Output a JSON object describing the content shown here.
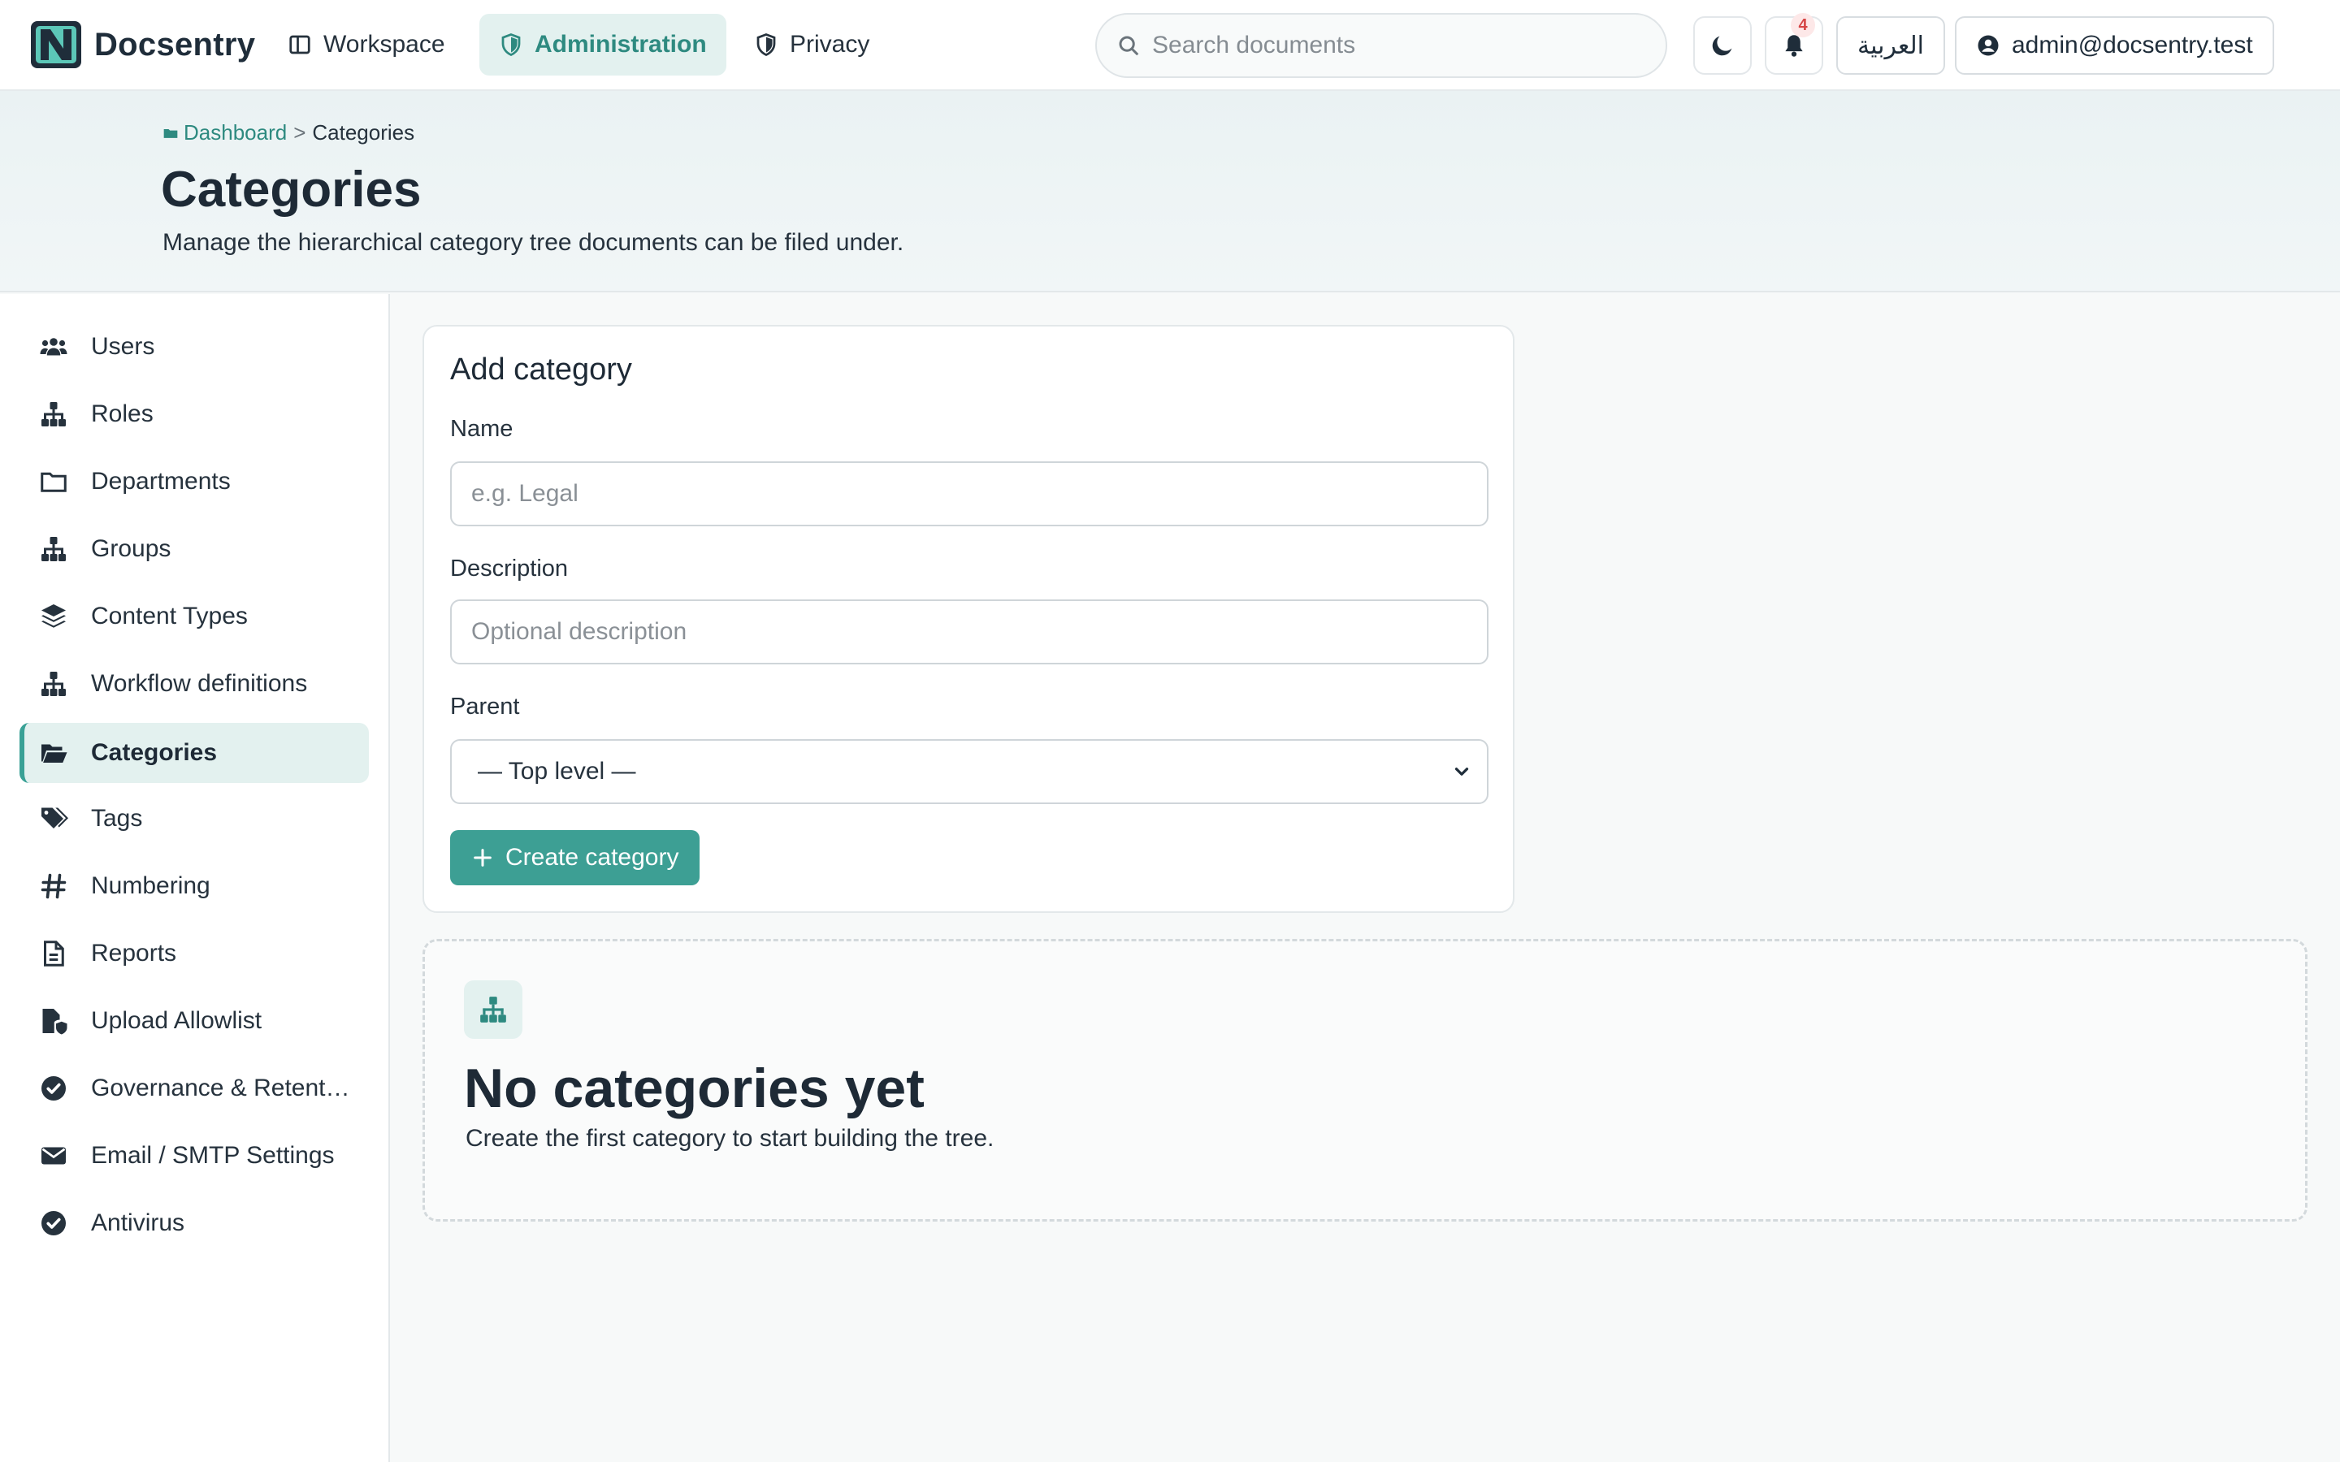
{
  "app": {
    "name": "Docsentry"
  },
  "nav": {
    "items": [
      {
        "label": "Workspace",
        "icon": "layout-icon"
      },
      {
        "label": "Administration",
        "icon": "shield-icon",
        "active": true
      },
      {
        "label": "Privacy",
        "icon": "shield-icon"
      }
    ]
  },
  "search": {
    "placeholder": "Search documents"
  },
  "header_actions": {
    "theme_icon": "moon-icon",
    "notifications_count": "4",
    "language_label": "العربية",
    "user_email": "admin@docsentry.test"
  },
  "breadcrumb": {
    "parent": "Dashboard",
    "separator": ">",
    "current": "Categories"
  },
  "page": {
    "title": "Categories",
    "subtitle": "Manage the hierarchical category tree documents can be filed under."
  },
  "sidebar": {
    "items": [
      {
        "label": "Users",
        "icon": "users-icon"
      },
      {
        "label": "Roles",
        "icon": "hierarchy-icon"
      },
      {
        "label": "Departments",
        "icon": "folder-icon"
      },
      {
        "label": "Groups",
        "icon": "hierarchy-icon"
      },
      {
        "label": "Content Types",
        "icon": "layers-icon"
      },
      {
        "label": "Workflow definitions",
        "icon": "hierarchy-icon"
      },
      {
        "label": "Categories",
        "icon": "folder-open-icon",
        "active": true
      },
      {
        "label": "Tags",
        "icon": "tags-icon"
      },
      {
        "label": "Numbering",
        "icon": "hash-icon"
      },
      {
        "label": "Reports",
        "icon": "file-icon"
      },
      {
        "label": "Upload Allowlist",
        "icon": "file-shield-icon"
      },
      {
        "label": "Governance & Retent…",
        "icon": "check-circle-icon"
      },
      {
        "label": "Email / SMTP Settings",
        "icon": "envelope-icon"
      },
      {
        "label": "Antivirus",
        "icon": "check-circle-icon"
      }
    ]
  },
  "form": {
    "title": "Add category",
    "name_label": "Name",
    "name_placeholder": "e.g. Legal",
    "description_label": "Description",
    "description_placeholder": "Optional description",
    "parent_label": "Parent",
    "parent_value": "— Top level —",
    "submit_label": "Create category"
  },
  "empty_state": {
    "icon": "hierarchy-icon",
    "title": "No categories yet",
    "text": "Create the first category to start building the tree."
  },
  "colors": {
    "accent": "#3d9f94",
    "accent_light": "#e3f1ef",
    "badge": "#d64545"
  }
}
